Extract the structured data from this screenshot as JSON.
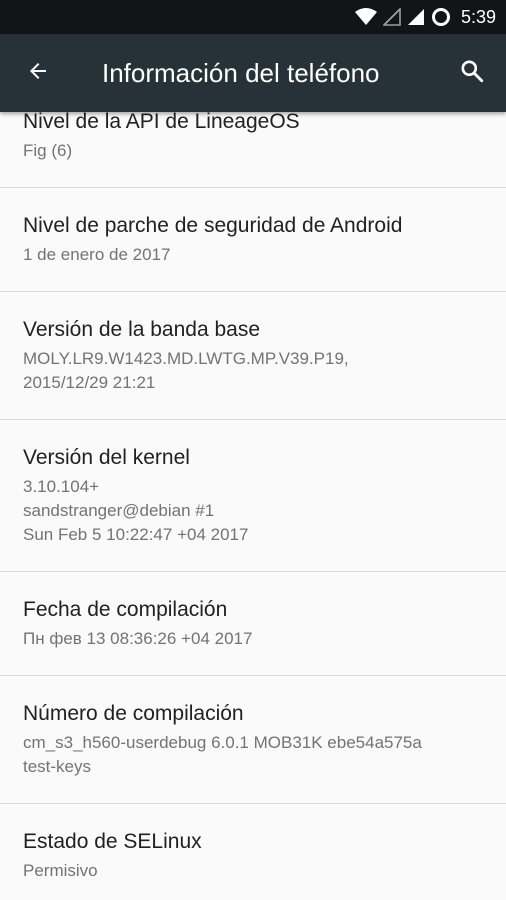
{
  "status_bar": {
    "time": "5:39",
    "icons": [
      "wifi-icon",
      "signal-icon",
      "signal-icon",
      "sync-icon"
    ]
  },
  "app_bar": {
    "title": "Información del teléfono",
    "back_icon": "arrow-back-icon",
    "search_icon": "search-icon",
    "background": "#263238"
  },
  "items": [
    {
      "title": "Nivel de la API de LineageOS",
      "summary": "Fig (6)"
    },
    {
      "title": "Nivel de parche de seguridad de Android",
      "summary": "1 de enero de 2017"
    },
    {
      "title": "Versión de la banda base",
      "summary": "MOLY.LR9.W1423.MD.LWTG.MP.V39.P19,\n2015/12/29 21:21"
    },
    {
      "title": "Versión del kernel",
      "summary": "3.10.104+\nsandstranger@debian #1\nSun Feb 5 10:22:47 +04 2017"
    },
    {
      "title": "Fecha de compilación",
      "summary": "Пн фев 13 08:36:26 +04 2017"
    },
    {
      "title": "Número de compilación",
      "summary": "cm_s3_h560-userdebug 6.0.1 MOB31K ebe54a575a\ntest-keys"
    },
    {
      "title": "Estado de SELinux",
      "summary": "Permisivo"
    }
  ]
}
